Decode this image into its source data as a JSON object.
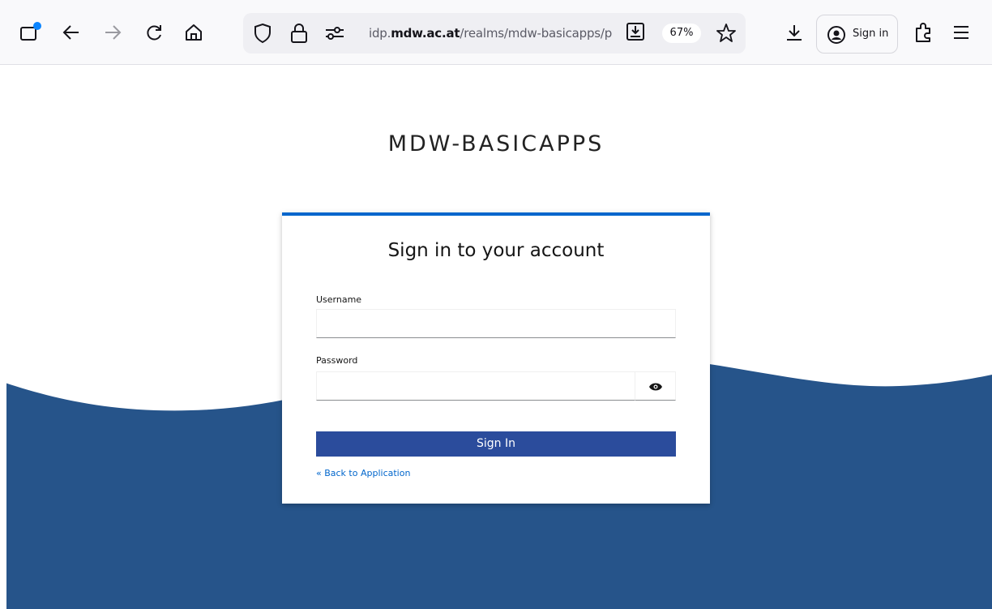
{
  "browser": {
    "url_host": "idp.",
    "url_domain": "mdw.ac.at",
    "url_path": "/realms/mdw-basicapps/prot",
    "zoom_level": "67%",
    "signin_label": "Sign in"
  },
  "page": {
    "realm_title": "MDW-BASICAPPS",
    "card_title": "Sign in to your account",
    "username_label": "Username",
    "username_value": "",
    "password_label": "Password",
    "password_value": "",
    "submit_label": "Sign In",
    "back_link": "« Back to Application"
  },
  "colors": {
    "accent": "#0066cc",
    "button": "#2b4c9c",
    "wave": "#26548a"
  }
}
